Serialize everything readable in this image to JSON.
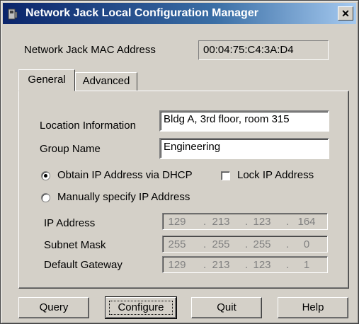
{
  "window": {
    "title": "Network Jack Local Configuration Manager",
    "close_glyph": "✕"
  },
  "mac": {
    "label": "Network Jack MAC Address",
    "value": "00:04:75:C4:3A:D4"
  },
  "tabs": [
    {
      "label": "General",
      "active": true
    },
    {
      "label": "Advanced",
      "active": false
    }
  ],
  "general": {
    "location_label": "Location Information",
    "location_value": "Bldg A, 3rd floor, room 315",
    "group_label": "Group Name",
    "group_value": "Engineering",
    "dhcp_label": "Obtain IP Address via DHCP",
    "dhcp_selected": true,
    "lock_label": "Lock IP Address",
    "lock_checked": false,
    "manual_label": "Manually specify IP Address",
    "manual_selected": false,
    "ip_label": "IP Address",
    "ip": [
      "129",
      "213",
      "123",
      "164"
    ],
    "subnet_label": "Subnet Mask",
    "subnet": [
      "255",
      "255",
      "255",
      "0"
    ],
    "gateway_label": "Default Gateway",
    "gateway": [
      "129",
      "213",
      "123",
      "1"
    ],
    "ip_sep": "."
  },
  "buttons": {
    "query": "Query",
    "configure": "Configure",
    "quit": "Quit",
    "help": "Help"
  }
}
